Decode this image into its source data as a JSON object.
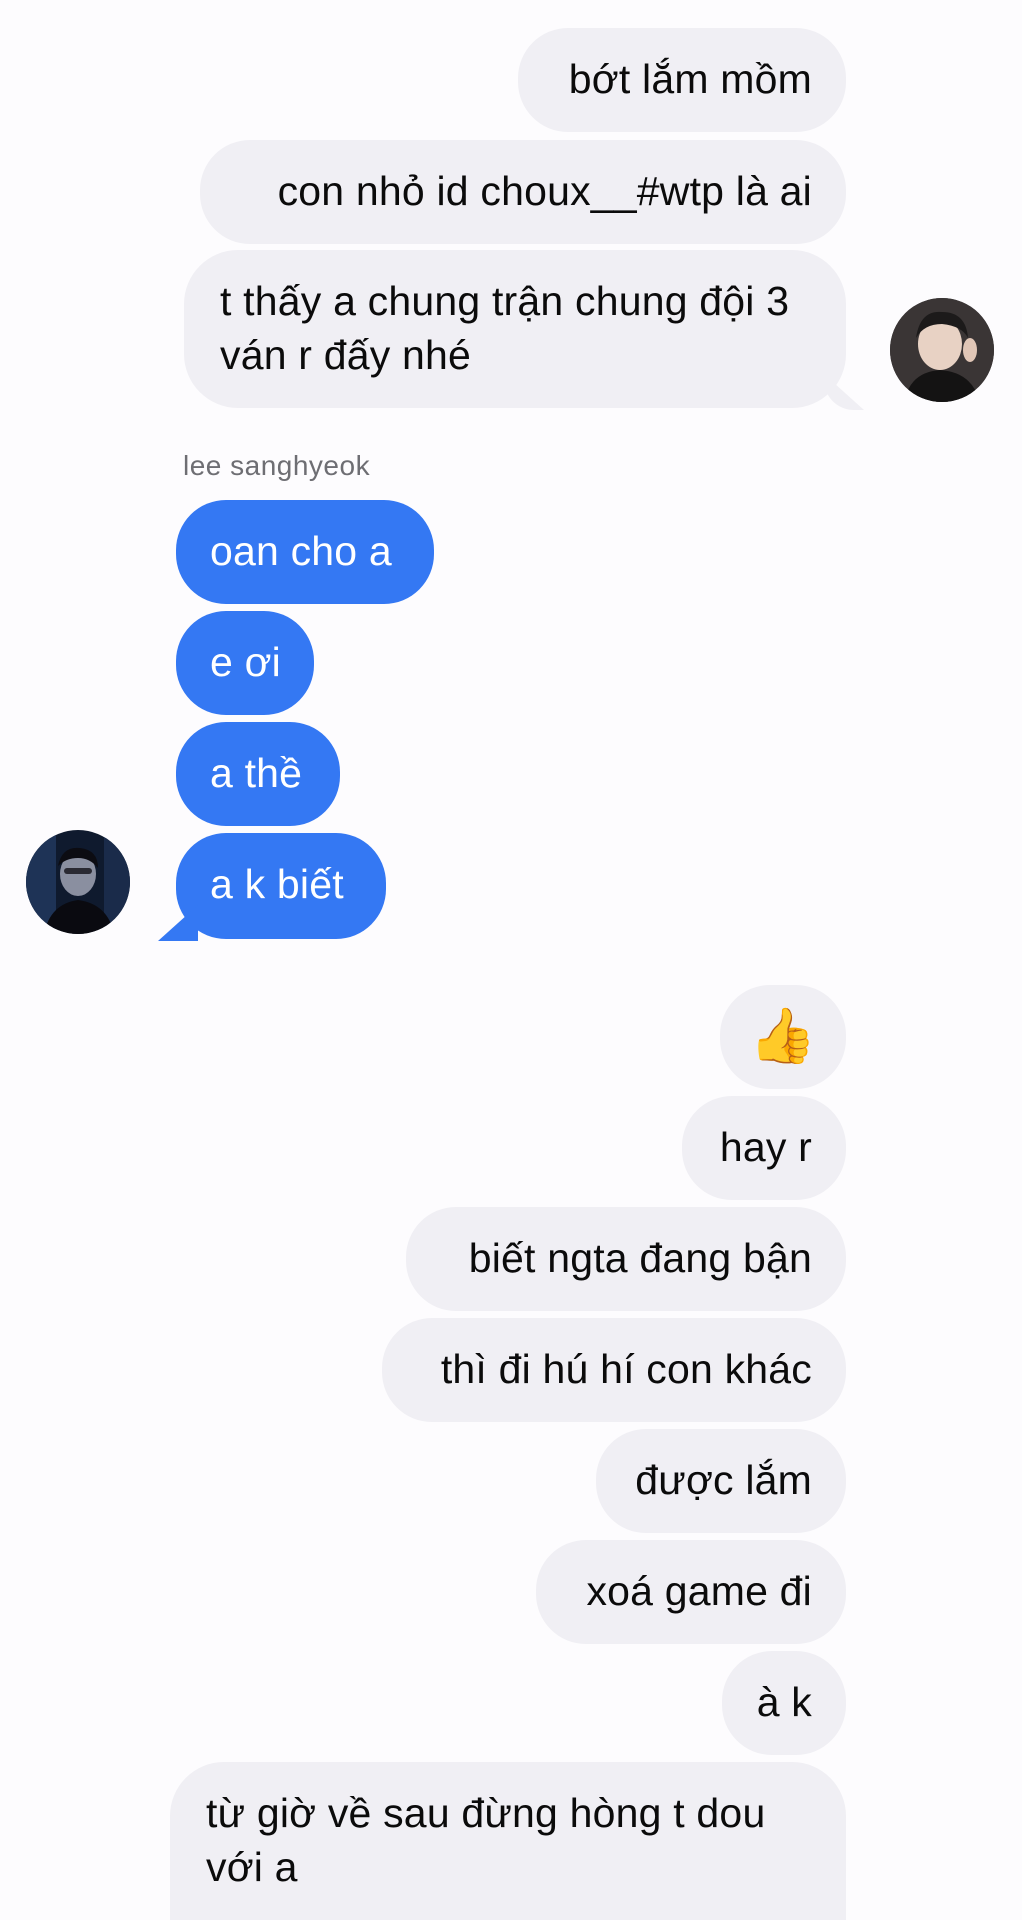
{
  "conversation": {
    "sent_group_1": [
      {
        "text": "bớt lắm mồm"
      },
      {
        "text": "con nhỏ id choux__#wtp là ai"
      },
      {
        "text": "t thấy a chung trận chung đội 3 ván r đấy nhé"
      }
    ],
    "received": {
      "sender_name": "lee sanghyeok",
      "messages": [
        {
          "text": "oan cho a"
        },
        {
          "text": "e ơi"
        },
        {
          "text": "a thề"
        },
        {
          "text": "a k biết"
        }
      ]
    },
    "sent_group_2": [
      {
        "text": "👍"
      },
      {
        "text": "hay r"
      },
      {
        "text": "biết ngta đang bận"
      },
      {
        "text": "thì đi hú hí con khác"
      },
      {
        "text": "được lắm"
      },
      {
        "text": "xoá game đi"
      },
      {
        "text": "à k"
      },
      {
        "text": "từ giờ về sau đừng hòng t dou với a"
      }
    ]
  },
  "colors": {
    "sent_bubble": "#f0eff4",
    "received_bubble": "#3478f3",
    "background": "#fdfcfe",
    "sender_name": "#6e6e73"
  },
  "icons": {
    "own_avatar": "user-avatar-photo",
    "contact_avatar": "contact-avatar-photo",
    "thumbs_up": "thumbs-up-emoji"
  }
}
